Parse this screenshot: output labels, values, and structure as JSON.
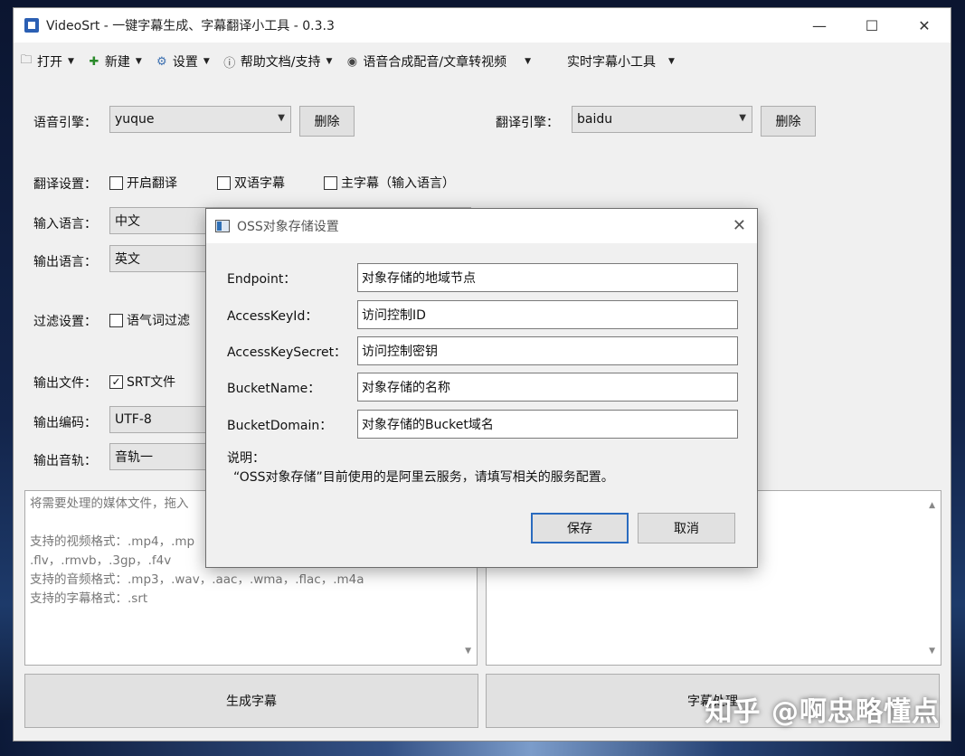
{
  "window": {
    "title": "VideoSrt - 一键字幕生成、字幕翻译小工具 - 0.3.3",
    "min": "—",
    "max": "☐",
    "close": "✕"
  },
  "menu": [
    {
      "label": "打开",
      "icon": "folder-icon"
    },
    {
      "label": "新建",
      "icon": "add-icon"
    },
    {
      "label": "设置",
      "icon": "gear-icon"
    },
    {
      "label": "帮助文档/支持",
      "icon": "info-icon"
    },
    {
      "label": "语音合成配音/文章转视频",
      "icon": "audio-icon"
    },
    {
      "label": "实时字幕小工具",
      "icon": ""
    }
  ],
  "main": {
    "speech_engine_label": "语音引擎：",
    "speech_engine_value": "yuque",
    "delete_label": "删除",
    "translate_engine_label": "翻译引擎：",
    "translate_engine_value": "baidu",
    "translate_settings_label": "翻译设置：",
    "enable_translate": "开启翻译",
    "bilingual": "双语字幕",
    "main_subtitle": "主字幕（输入语言）",
    "input_lang_label": "输入语言：",
    "input_lang_value": "中文",
    "output_lang_label": "输出语言：",
    "output_lang_value": "英文",
    "filter_label": "过滤设置：",
    "filter_option": "语气词过滤",
    "output_file_label": "输出文件：",
    "output_file_option": "SRT文件",
    "output_encoding_label": "输出编码：",
    "output_encoding_value": "UTF-8",
    "output_track_label": "输出音轨：",
    "output_track_value": "音轨一",
    "drop_text": [
      "将需要处理的媒体文件，拖入",
      "",
      "支持的视频格式：.mp4，.mp",
      ".flv，.rmvb，.3gp，.f4v",
      "支持的音频格式：.mp3，.wav，.aac，.wma，.flac，.m4a",
      "支持的字幕格式：.srt"
    ],
    "generate_button": "生成字幕",
    "process_button": "字幕处理"
  },
  "dialog": {
    "title": "OSS对象存储设置",
    "close": "✕",
    "fields": [
      {
        "label": "Endpoint：",
        "value": "对象存储的地域节点"
      },
      {
        "label": "AccessKeyId：",
        "value": "访问控制ID"
      },
      {
        "label": "AccessKeySecret：",
        "value": "访问控制密钥"
      },
      {
        "label": "BucketName：",
        "value": "对象存储的名称"
      },
      {
        "label": "BucketDomain：",
        "value": "对象存储的Bucket域名"
      }
    ],
    "note_title": "说明：",
    "note_text": "“OSS对象存储”目前使用的是阿里云服务，请填写相关的服务配置。",
    "save": "保存",
    "cancel": "取消"
  },
  "watermark": "知乎 @啊忠略懂点"
}
